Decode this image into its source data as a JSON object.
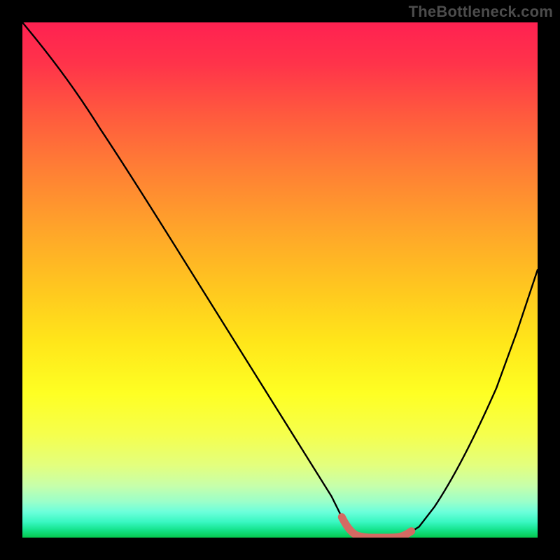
{
  "watermark": "TheBottleneck.com",
  "chart_data": {
    "type": "line",
    "title": "",
    "xlabel": "",
    "ylabel": "",
    "xlim": [
      0,
      100
    ],
    "ylim": [
      0,
      100
    ],
    "grid": false,
    "legend": false,
    "x": [
      0,
      5,
      10,
      15,
      20,
      25,
      30,
      35,
      40,
      45,
      50,
      55,
      60,
      62,
      64,
      66,
      68,
      70,
      72,
      74,
      76,
      80,
      85,
      90,
      95,
      100
    ],
    "values": [
      100,
      94,
      87,
      79.5,
      72,
      64,
      56,
      48,
      40,
      32,
      24,
      16,
      8,
      4,
      1.5,
      0.4,
      0,
      0,
      0,
      0.4,
      1.5,
      6,
      15,
      26,
      38,
      52
    ],
    "annotations": [
      {
        "label": "highlight-range",
        "x_start": 62,
        "x_end": 75,
        "color": "#d46a63"
      }
    ],
    "background_gradient": [
      "#ff2151",
      "#ff334a",
      "#ff5a3e",
      "#ff7d35",
      "#ffa42a",
      "#ffc81f",
      "#ffe61a",
      "#feff23",
      "#f5ff4d",
      "#e3ff7e",
      "#c6ffab",
      "#9bffc9",
      "#6cffdb",
      "#38f7c1",
      "#14e38c",
      "#06c84f"
    ]
  }
}
